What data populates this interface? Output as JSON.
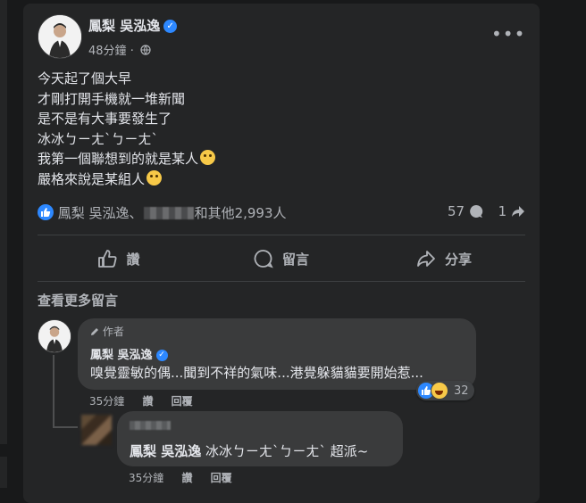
{
  "post": {
    "author": "鳳梨 吳泓逸",
    "timestamp": "48分鐘",
    "lines": [
      "今天起了個大早",
      "才剛打開手機就一堆新聞",
      "是不是有大事要發生了",
      "冰冰ㄅㄧㄤˋㄅㄧㄤˋ",
      "我第一個聯想到的就是某人",
      "嚴格來說是某組人"
    ],
    "reactions": {
      "prefix": "鳳梨 吳泓逸、",
      "suffix": "和其他2,993人",
      "comments_count": "57",
      "shares_count": "1"
    },
    "actions": {
      "like": "讚",
      "comment": "留言",
      "share": "分享"
    },
    "view_more": "查看更多留言"
  },
  "comments": [
    {
      "badge": "作者",
      "name": "鳳梨 吳泓逸",
      "text": "嗅覺靈敏的偶...聞到不祥的氣味...港覺躲貓貓要開始惹...",
      "time": "35分鐘",
      "like": "讚",
      "reply": "回覆",
      "reaction_count": "32"
    },
    {
      "mention": "鳳梨 吳泓逸",
      "text": " 冰冰ㄅㄧㄤˋㄅㄧㄤˋ 超派~",
      "time": "35分鐘",
      "like": "讚",
      "reply": "回覆"
    }
  ],
  "colors": {
    "background": "#18191a",
    "card": "#242526",
    "bubble": "#3a3b3c",
    "accent": "#2d88ff",
    "text_primary": "#e4e6eb",
    "text_secondary": "#b0b3b8"
  },
  "icons": [
    "verified-badge-icon",
    "globe-icon",
    "more-options-icon",
    "like-reaction-icon",
    "comment-icon",
    "share-icon",
    "haha-reaction-icon",
    "pencil-icon"
  ]
}
